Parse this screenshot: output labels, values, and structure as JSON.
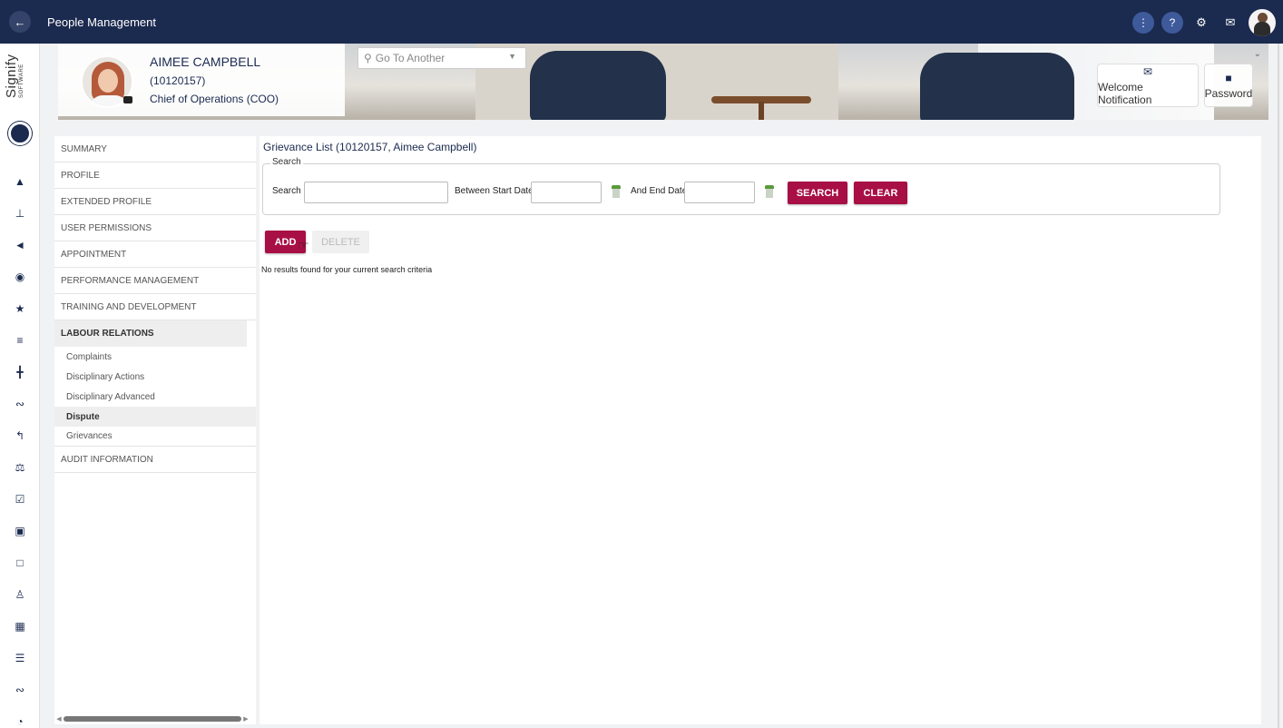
{
  "topbar": {
    "back_icon": "arrow-left-icon",
    "title": "People Management",
    "icons": [
      "more-vertical-icon",
      "help-icon",
      "gear-icon",
      "mail-icon"
    ]
  },
  "rail": {
    "logo_text": "Signify",
    "logo_sub": "SOFTWARE",
    "icons": [
      "megaphone-icon",
      "org-chart-icon",
      "graduation-cap-icon",
      "compass-icon",
      "star-icon",
      "sliders-icon",
      "signpost-icon",
      "handshake-icon",
      "route-icon",
      "scales-icon",
      "checkbox-icon",
      "briefcase-icon",
      "laptop-icon",
      "add-user-icon",
      "id-badge-icon",
      "list-icon",
      "handshake-2-icon",
      "pie-chart-icon"
    ]
  },
  "profile": {
    "name": "AIMEE CAMPBELL",
    "id": "(10120157)",
    "title": "Chief of Operations (COO)"
  },
  "goto": {
    "placeholder": "Go To Another"
  },
  "banner_buttons": {
    "welcome": "Welcome Notification",
    "password": "Password"
  },
  "menu": {
    "items_top": [
      "SUMMARY",
      "PROFILE",
      "EXTENDED PROFILE",
      "USER PERMISSIONS",
      "APPOINTMENT",
      "PERFORMANCE MANAGEMENT",
      "TRAINING AND DEVELOPMENT"
    ],
    "active_section": "LABOUR RELATIONS",
    "sub_items": [
      "Complaints",
      "Disciplinary Actions",
      "Disciplinary Advanced",
      "Dispute",
      "Grievances"
    ],
    "active_sub": "Dispute",
    "items_bottom": [
      "AUDIT INFORMATION"
    ]
  },
  "main": {
    "title": "Grievance List (10120157, Aimee Campbell)",
    "search_legend": "Search",
    "search_label": "Search",
    "start_label": "Between Start Date",
    "end_label": "And End Date",
    "search_btn": "SEARCH",
    "clear_btn": "CLEAR",
    "add_btn": "ADD",
    "delete_btn": "DELETE",
    "no_results": "No results found for your current search criteria"
  },
  "colors": {
    "navy": "#1b2a4f",
    "accent": "#a80f45"
  }
}
